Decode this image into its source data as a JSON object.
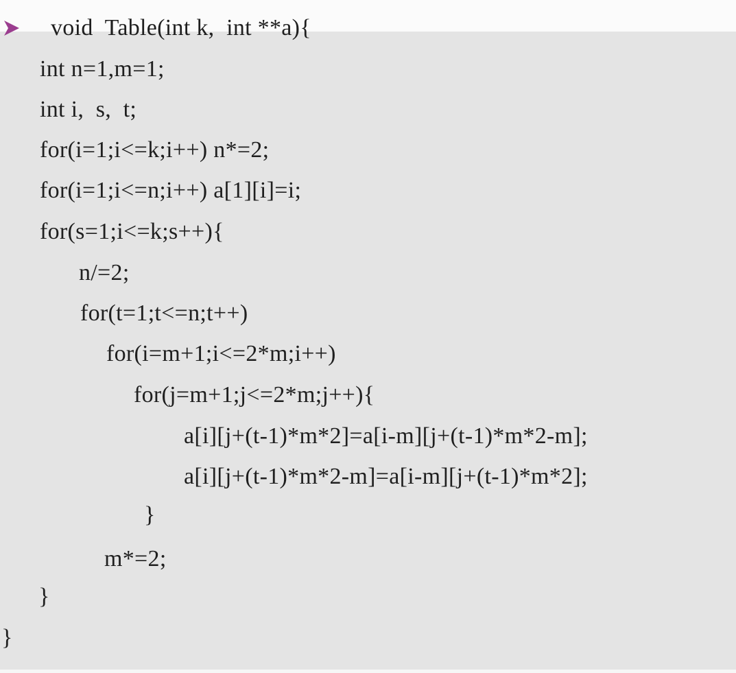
{
  "slide": {
    "bullet_icon": "arrow-bullet-icon",
    "bullet_color": "#9b3d8f",
    "background_color": "#e4e4e4",
    "code_lines": [
      "void  Table(int k,  int **a){",
      "int n=1,m=1;",
      "int i,  s,  t;",
      "for(i=1;i<=k;i++) n*=2;",
      "for(i=1;i<=n;i++) a[1][i]=i;",
      "for(s=1;i<=k;s++){",
      "n/=2;",
      "for(t=1;t<=n;t++)",
      "for(i=m+1;i<=2*m;i++)",
      "for(j=m+1;j<=2*m;j++){",
      "a[i][j+(t-1)*m*2]=a[i-m][j+(t-1)*m*2-m];",
      "a[i][j+(t-1)*m*2-m]=a[i-m][j+(t-1)*m*2];",
      "}",
      "m*=2;",
      "}",
      "}"
    ]
  }
}
